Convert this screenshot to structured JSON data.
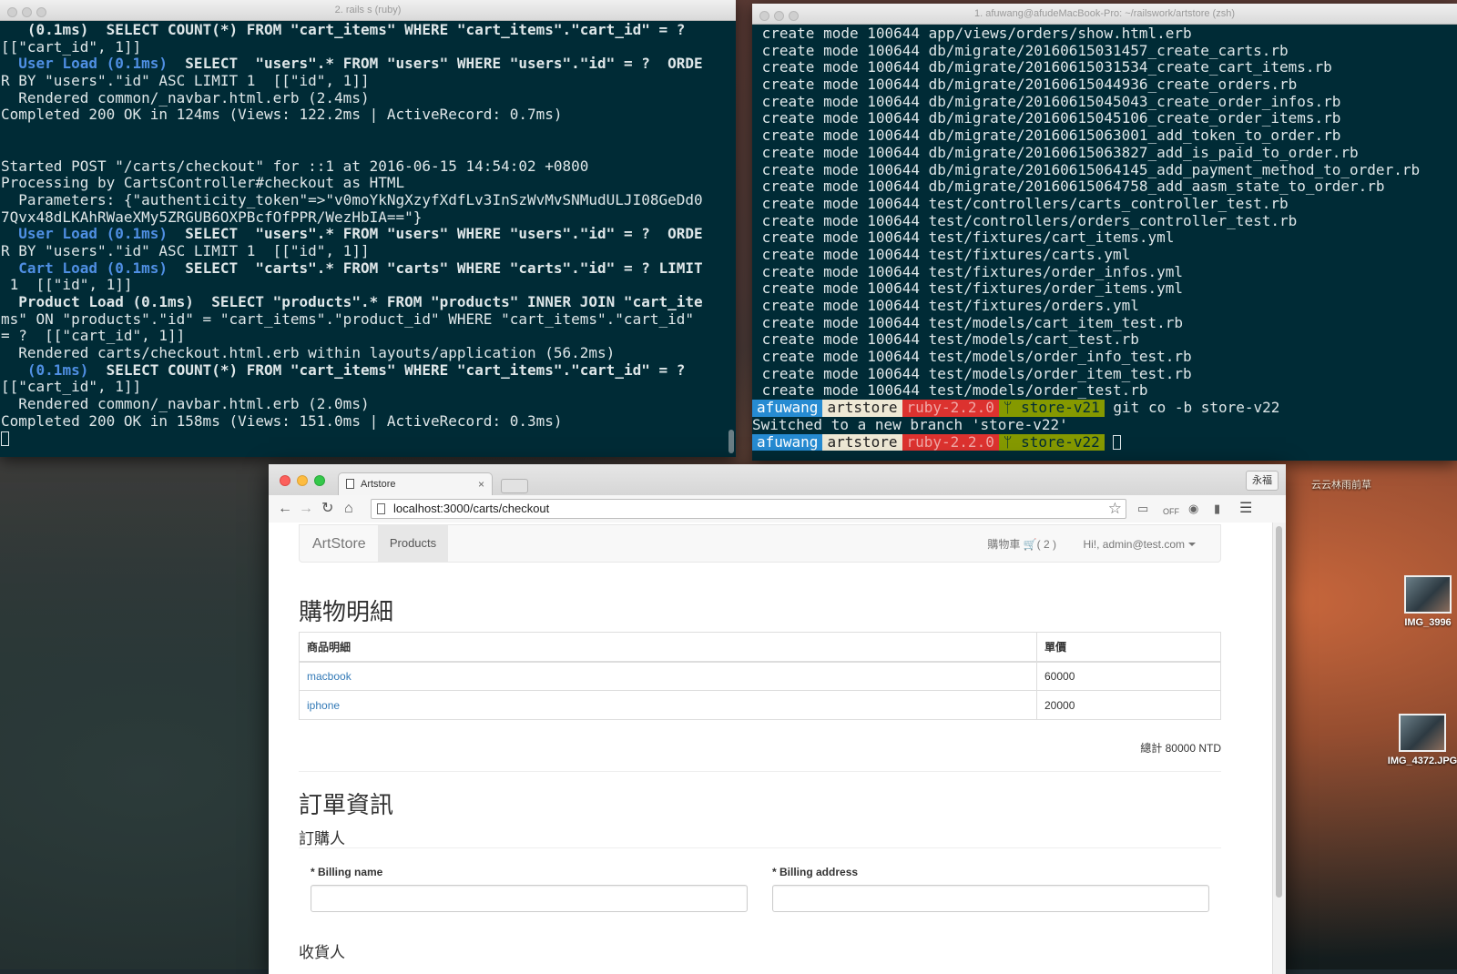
{
  "terminal_left": {
    "title": "2. rails s (ruby)",
    "lines": [
      "   (0.1ms)  SELECT COUNT(*) FROM \"cart_items\" WHERE \"cart_items\".\"cart_id\" = ?",
      "[[\"cart_id\", 1]]",
      "  User Load (0.1ms)  SELECT  \"users\".* FROM \"users\" WHERE \"users\".\"id\" = ?  ORDE",
      "R BY \"users\".\"id\" ASC LIMIT 1  [[\"id\", 1]]",
      "  Rendered common/_navbar.html.erb (2.4ms)",
      "Completed 200 OK in 124ms (Views: 122.2ms | ActiveRecord: 0.7ms)",
      "",
      "",
      "Started POST \"/carts/checkout\" for ::1 at 2016-06-15 14:54:02 +0800",
      "Processing by CartsController#checkout as HTML",
      "  Parameters: {\"authenticity_token\"=>\"v0moYkNgXzyfXdfLv3InSzWvMvSNMudULJI08GeDd0",
      "7Qvx48dLKAhRWaeXMy5ZRGUB6OXPBcfOfPPR/WezHbIA==\"}",
      "  User Load (0.1ms)  SELECT  \"users\".* FROM \"users\" WHERE \"users\".\"id\" = ?  ORDE",
      "R BY \"users\".\"id\" ASC LIMIT 1  [[\"id\", 1]]",
      "  Cart Load (0.1ms)  SELECT  \"carts\".* FROM \"carts\" WHERE \"carts\".\"id\" = ? LIMIT",
      " 1  [[\"id\", 1]]",
      "  Product Load (0.1ms)  SELECT \"products\".* FROM \"products\" INNER JOIN \"cart_ite",
      "ms\" ON \"products\".\"id\" = \"cart_items\".\"product_id\" WHERE \"cart_items\".\"cart_id\"",
      "= ?  [[\"cart_id\", 1]]",
      "  Rendered carts/checkout.html.erb within layouts/application (56.2ms)",
      "   (0.1ms)  SELECT COUNT(*) FROM \"cart_items\" WHERE \"cart_items\".\"cart_id\" = ?",
      "[[\"cart_id\", 1]]",
      "  Rendered common/_navbar.html.erb (2.0ms)",
      "Completed 200 OK in 158ms (Views: 151.0ms | ActiveRecord: 0.3ms)"
    ]
  },
  "terminal_right": {
    "title": "1. afuwang@afudeMacBook-Pro: ~/railswork/artstore (zsh)",
    "lines": [
      " create mode 100644 app/views/orders/show.html.erb",
      " create mode 100644 db/migrate/20160615031457_create_carts.rb",
      " create mode 100644 db/migrate/20160615031534_create_cart_items.rb",
      " create mode 100644 db/migrate/20160615044936_create_orders.rb",
      " create mode 100644 db/migrate/20160615045043_create_order_infos.rb",
      " create mode 100644 db/migrate/20160615045106_create_order_items.rb",
      " create mode 100644 db/migrate/20160615063001_add_token_to_order.rb",
      " create mode 100644 db/migrate/20160615063827_add_is_paid_to_order.rb",
      " create mode 100644 db/migrate/20160615064145_add_payment_method_to_order.rb",
      " create mode 100644 db/migrate/20160615064758_add_aasm_state_to_order.rb",
      " create mode 100644 test/controllers/carts_controller_test.rb",
      " create mode 100644 test/controllers/orders_controller_test.rb",
      " create mode 100644 test/fixtures/cart_items.yml",
      " create mode 100644 test/fixtures/carts.yml",
      " create mode 100644 test/fixtures/order_infos.yml",
      " create mode 100644 test/fixtures/order_items.yml",
      " create mode 100644 test/fixtures/orders.yml",
      " create mode 100644 test/models/cart_item_test.rb",
      " create mode 100644 test/models/cart_test.rb",
      " create mode 100644 test/models/order_info_test.rb",
      " create mode 100644 test/models/order_item_test.rb",
      " create mode 100644 test/models/order_test.rb"
    ],
    "prompt": {
      "user": "afuwang",
      "dir": "artstore",
      "ruby": "ruby-2.2.0",
      "branch_1": "store-v21",
      "command": "git co -b store-v22",
      "output": "Switched to a new branch 'store-v22'",
      "branch_2": "store-v22"
    }
  },
  "desktop": {
    "label_top": "云云林雨前草",
    "icon_1": "IMG_3996",
    "icon_2": "IMG_4372.JPG"
  },
  "browser": {
    "tab_title": "Artstore",
    "tab_close": "×",
    "profile": "永福",
    "url": "localhost:3000/carts/checkout"
  },
  "page": {
    "brand": "ArtStore",
    "nav_products": "Products",
    "cart_label": "購物車",
    "cart_count": "( 2 )",
    "user_menu": "Hi!, admin@test.com",
    "cart_heading": "購物明細",
    "table_headers": [
      "商品明細",
      "單價"
    ],
    "rows": [
      {
        "name": "macbook",
        "price": "60000"
      },
      {
        "name": "iphone",
        "price": "20000"
      }
    ],
    "total": "總計 80000 NTD",
    "order_heading": "訂單資訊",
    "buyer_heading": "訂購人",
    "billing_name_label": "Billing name",
    "billing_address_label": "Billing address",
    "required_mark": "*",
    "receiver_heading": "收貨人"
  }
}
